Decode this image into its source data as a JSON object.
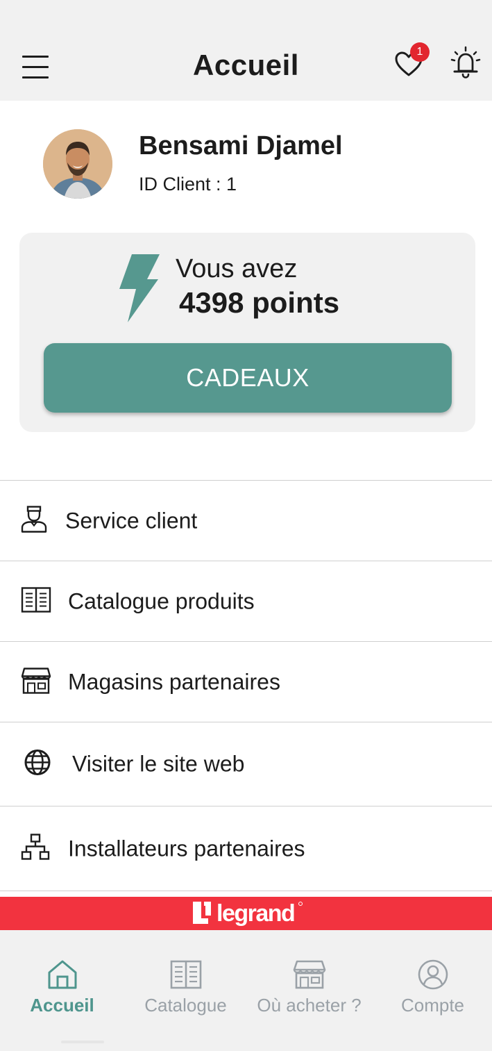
{
  "header": {
    "title": "Accueil",
    "menu_icon": "hamburger-menu-icon",
    "favorites_icon": "heart-icon",
    "favorites_badge": "1",
    "notifications_icon": "bell-icon"
  },
  "profile": {
    "name": "Bensami Djamel",
    "client_id": "ID Client : 1"
  },
  "points_card": {
    "label": "Vous avez",
    "value": "4398 points",
    "icon": "lightning-bolt-icon",
    "button_label": "CADEAUX"
  },
  "menu": [
    {
      "label": "Service client",
      "icon": "customer-service-agent-icon"
    },
    {
      "label": "Catalogue produits",
      "icon": "open-book-icon"
    },
    {
      "label": "Magasins partenaires",
      "icon": "storefront-icon"
    },
    {
      "label": "Visiter le site web",
      "icon": "globe-icon"
    },
    {
      "label": "Installateurs partenaires",
      "icon": "network-hierarchy-icon"
    }
  ],
  "brand": {
    "name": "legrand"
  },
  "bottom_nav": [
    {
      "label": "Accueil",
      "icon": "home-icon",
      "active": true
    },
    {
      "label": "Catalogue",
      "icon": "open-book-icon",
      "active": false
    },
    {
      "label": "Où acheter ?",
      "icon": "storefront-icon",
      "active": false
    },
    {
      "label": "Compte",
      "icon": "user-circle-icon",
      "active": false
    }
  ],
  "colors": {
    "accent": "#56988f",
    "nav_active": "#4e958d",
    "nav_inactive": "#9aa1a7",
    "badge": "#e2262f",
    "brand_red": "#f2333f",
    "header_bg": "#f1f1f1"
  }
}
